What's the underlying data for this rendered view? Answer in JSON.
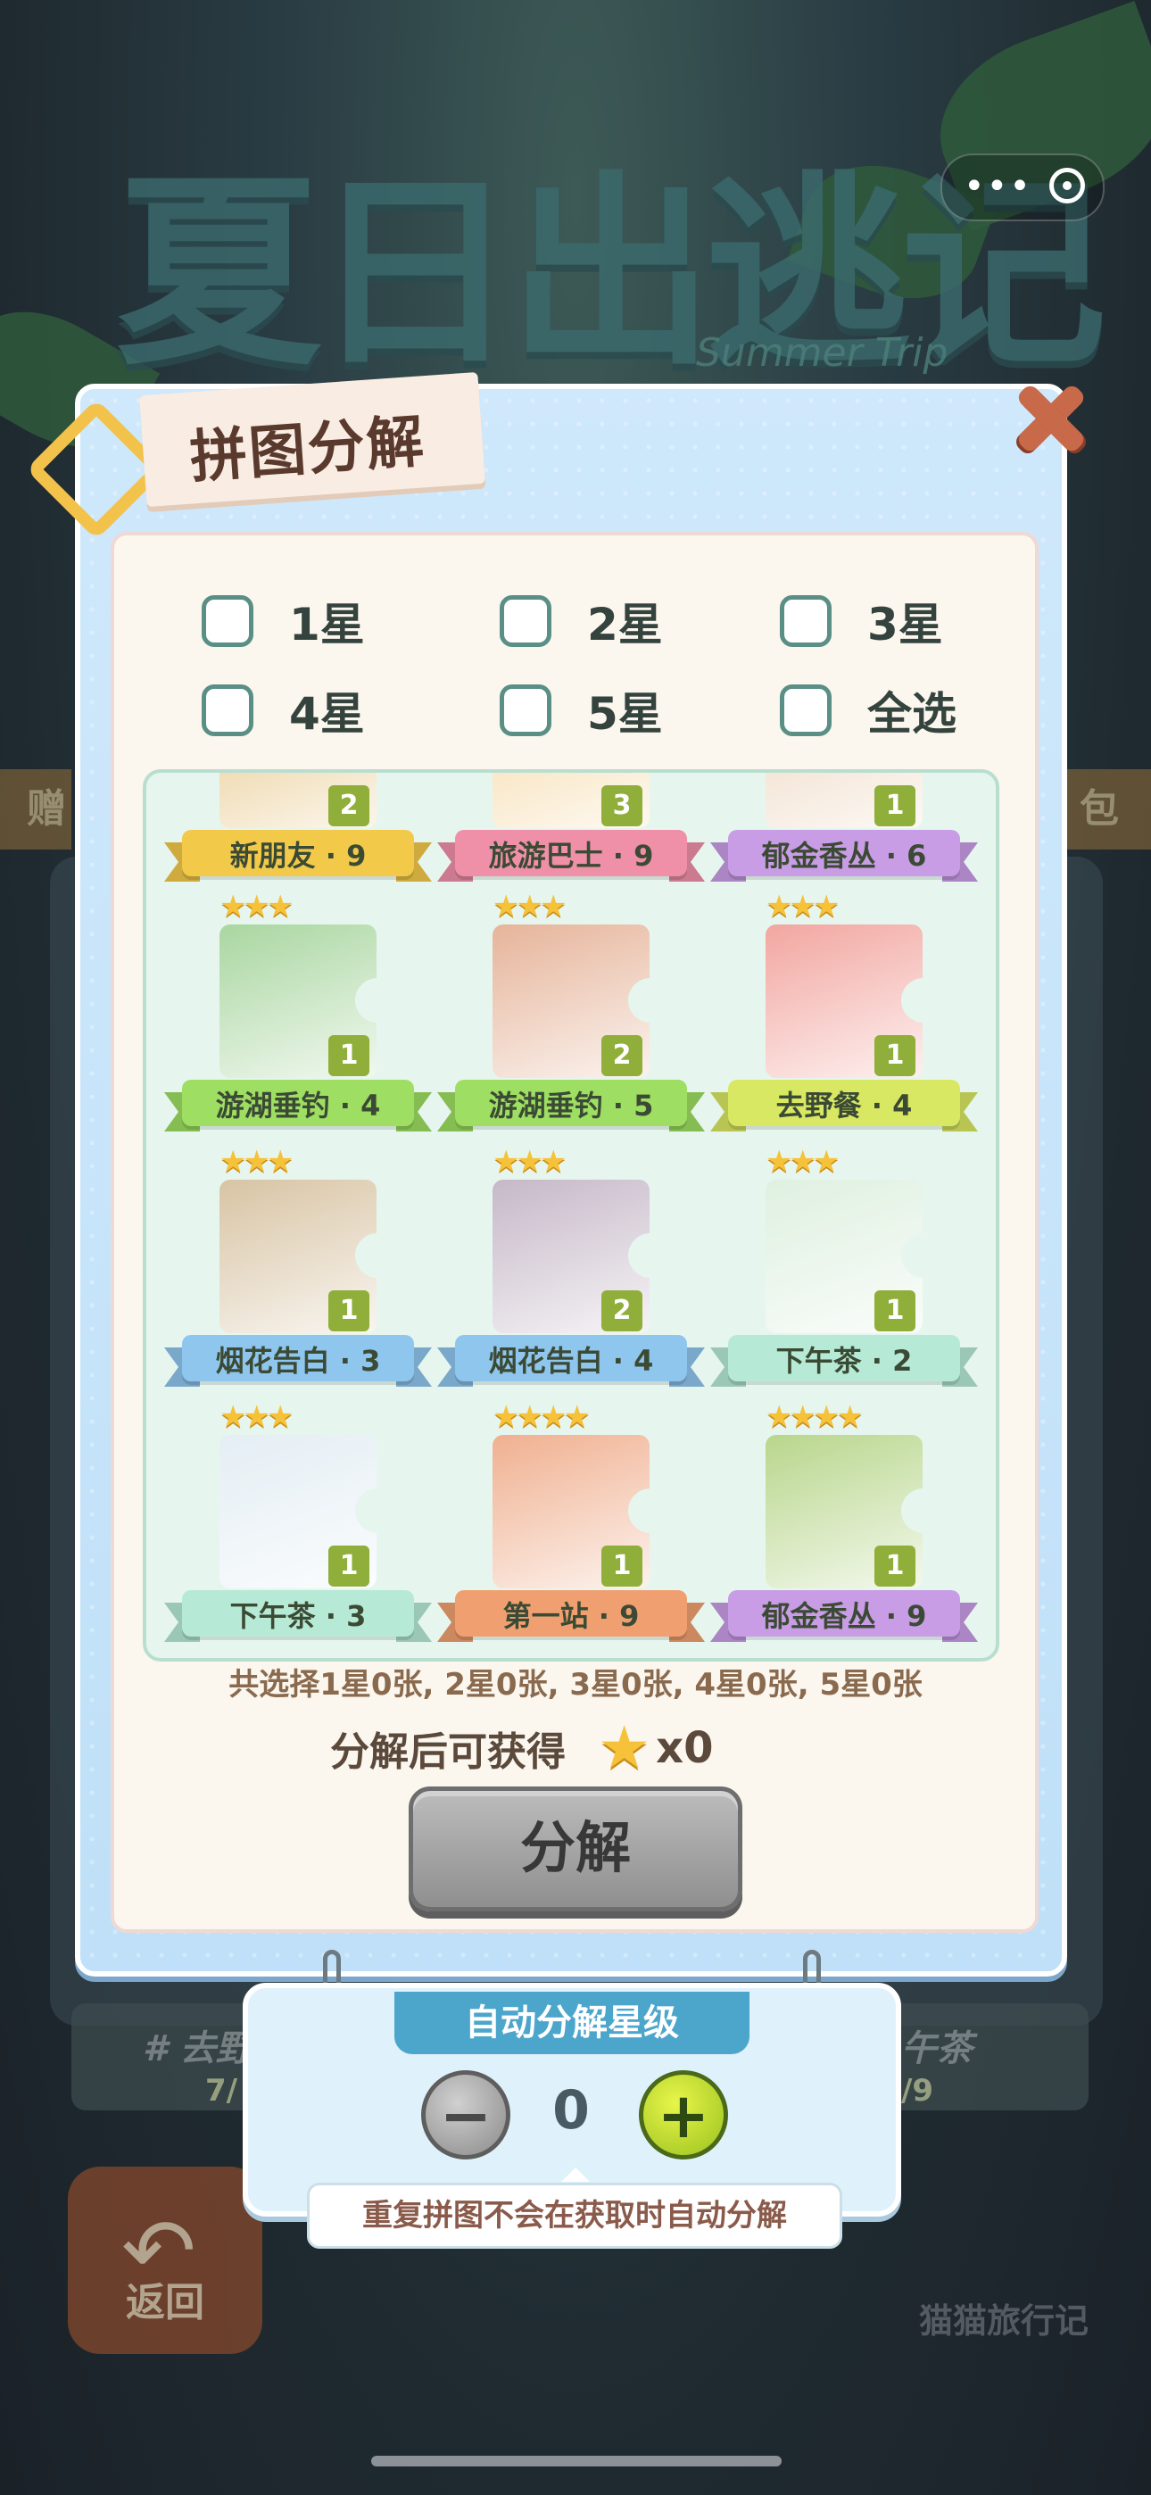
{
  "background": {
    "logo_text": "夏日出逃记",
    "logo_sub": "Summer Trip",
    "side_left": "赠",
    "side_right": "包",
    "bar_left": "# 去野",
    "bar_left_progress": "7/",
    "bar_right": "午茶",
    "bar_right_progress": "/9",
    "back_label": "返回",
    "brand": "猫猫旅行记"
  },
  "capsule": {
    "more": "•••"
  },
  "dialog": {
    "title": "拼图分解",
    "filters": [
      "1星",
      "2星",
      "3星",
      "4星",
      "5星",
      "全选"
    ],
    "summary": "共选择1星0张, 2星0张, 3星0张, 4星0张, 5星0张",
    "gain_label": "分解后可获得",
    "gain_count": "x0",
    "split_button": "分解"
  },
  "cards": [
    {
      "name": "新朋友 · 9",
      "count": "2",
      "stars": "",
      "color": "#f3c94a"
    },
    {
      "name": "旅游巴士 · 9",
      "count": "3",
      "stars": "",
      "color": "#ef8fa8"
    },
    {
      "name": "郁金香丛 · 6",
      "count": "1",
      "stars": "",
      "color": "#c99ce6"
    },
    {
      "name": "游湖垂钓 · 4",
      "count": "1",
      "stars": "★★★",
      "color": "#9ede62"
    },
    {
      "name": "游湖垂钓 · 5",
      "count": "2",
      "stars": "★★★",
      "color": "#9ede62"
    },
    {
      "name": "去野餐 · 4",
      "count": "1",
      "stars": "★★★",
      "color": "#d8e862"
    },
    {
      "name": "烟花告白 · 3",
      "count": "1",
      "stars": "★★★",
      "color": "#8fc6ee"
    },
    {
      "name": "烟花告白 · 4",
      "count": "2",
      "stars": "★★★",
      "color": "#8fc6ee"
    },
    {
      "name": "下午茶 · 2",
      "count": "1",
      "stars": "★★★",
      "color": "#b6ead6"
    },
    {
      "name": "下午茶 · 3",
      "count": "1",
      "stars": "★★★",
      "color": "#b6ead6"
    },
    {
      "name": "第一站 · 9",
      "count": "1",
      "stars": "★★★★",
      "color": "#f0a070"
    },
    {
      "name": "郁金香丛 · 9",
      "count": "1",
      "stars": "★★★★",
      "color": "#c99ce6"
    }
  ],
  "auto": {
    "title": "自动分解星级",
    "value": "0",
    "minus": "−",
    "plus": "+",
    "tip": "重复拼图不会在获取时自动分解"
  }
}
